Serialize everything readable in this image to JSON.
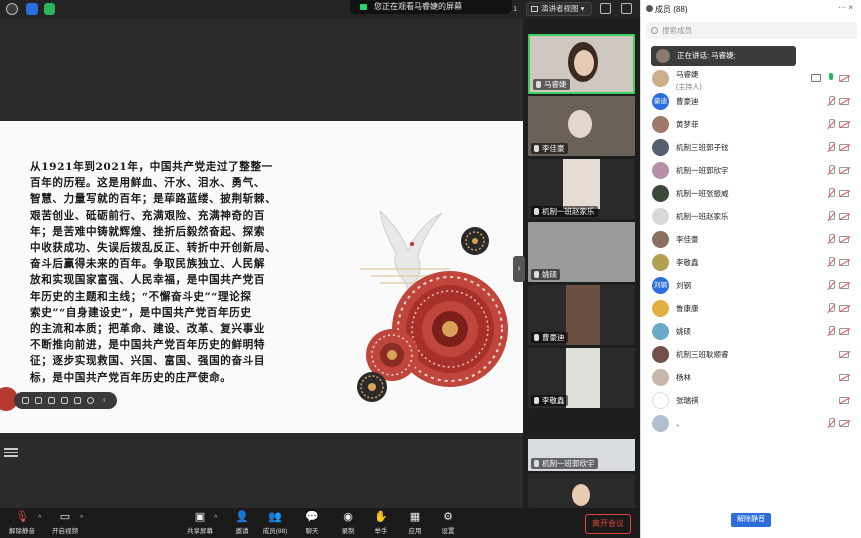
{
  "topbar": {
    "banner_text": "您正在观看马睿婕的屏幕",
    "view_button": "演讲者视图",
    "hidden_fragment": "1"
  },
  "slide": {
    "lines": [
      "从1921年到2021年，中国共产党走过了整整一",
      "百年的历程。这是用鲜血、汗水、泪水、勇气、",
      "智慧、力量写就的百年；是荜路蓝缕、披荆斩棘、",
      "艰苦创业、砥砺前行、充满艰险、充满神奇的百",
      "年；是苦难中铸就辉煌、挫折后毅然奋起、探索",
      "中收获成功、失误后拨乱反正、转折中开创新局、",
      "奋斗后赢得未来的百年。争取民族独立、人民解",
      "放和实现国家富强、人民幸福，是中国共产党百",
      "年历史的主题和主线；“不懈奋斗史”“理论探",
      "索史”“自身建设史”，是中国共产党百年历史",
      "的主流和本质；把革命、建设、改革、复兴事业",
      "不断推向前进，是中国共产党百年历史的鲜明特",
      "征；逐步实现救国、兴国、富国、强国的奋斗目",
      "标，是中国共产党百年历史的庄严使命。"
    ]
  },
  "gallery": {
    "tiles": [
      {
        "name": "马睿婕",
        "active": true
      },
      {
        "name": "李佳豪",
        "active": false
      },
      {
        "name": "机制一班赵家乐",
        "active": false
      },
      {
        "name": "姚硕",
        "active": false
      },
      {
        "name": "曹豪迪",
        "active": false
      },
      {
        "name": "李敬鑫",
        "active": false
      },
      {
        "name": "机制一班郭欣宇",
        "active": false
      }
    ]
  },
  "toolbar": {
    "mute": "解除静音",
    "video": "开启视频",
    "share": "共享屏幕",
    "invite": "邀请",
    "members": "成员(88)",
    "chat": "聊天",
    "record": "录制",
    "raise_hand": "举手",
    "apps": "应用",
    "settings": "设置",
    "leave": "离开会议"
  },
  "panel": {
    "title": "成员 (88)",
    "actions": "··· ×",
    "search_placeholder": "搜索成员",
    "speaking": "正在讲话: 马睿婕;",
    "mute_all": "解除静音",
    "participants": [
      {
        "name": "马睿婕",
        "sub": "(主持人)",
        "avatar_text": "",
        "avatar_color": "#c9b08a",
        "mic": "on",
        "cam": "off",
        "share": true
      },
      {
        "name": "曹豪迪",
        "sub": "",
        "avatar_text": "豪迪",
        "avatar_color": "#2a6fdb",
        "mic": "off",
        "cam": "off",
        "share": false
      },
      {
        "name": "黄梦菲",
        "sub": "",
        "avatar_text": "",
        "avatar_color": "#a0786a",
        "mic": "off",
        "cam": "off",
        "share": false
      },
      {
        "name": "机制三班郭子铉",
        "sub": "",
        "avatar_text": "",
        "avatar_color": "#555f6e",
        "mic": "off",
        "cam": "off",
        "share": false
      },
      {
        "name": "机制一班郭欣宇",
        "sub": "",
        "avatar_text": "",
        "avatar_color": "#b58fa8",
        "mic": "off",
        "cam": "off",
        "share": false
      },
      {
        "name": "机制一班张振威",
        "sub": "",
        "avatar_text": "",
        "avatar_color": "#3a4a3a",
        "mic": "off",
        "cam": "off",
        "share": false
      },
      {
        "name": "机制一班赵家乐",
        "sub": "",
        "avatar_text": "",
        "avatar_color": "#d8d8d8",
        "mic": "off",
        "cam": "off",
        "share": false
      },
      {
        "name": "李佳豪",
        "sub": "",
        "avatar_text": "",
        "avatar_color": "#8a7060",
        "mic": "off",
        "cam": "off",
        "share": false
      },
      {
        "name": "李敬鑫",
        "sub": "",
        "avatar_text": "",
        "avatar_color": "#b0a050",
        "mic": "off",
        "cam": "off",
        "share": false
      },
      {
        "name": "刘钢",
        "sub": "",
        "avatar_text": "刘钢",
        "avatar_color": "#2a6fdb",
        "mic": "off",
        "cam": "off",
        "share": false
      },
      {
        "name": "鲁康康",
        "sub": "",
        "avatar_text": "",
        "avatar_color": "#e0b040",
        "mic": "off",
        "cam": "off",
        "share": false
      },
      {
        "name": "姚硕",
        "sub": "",
        "avatar_text": "",
        "avatar_color": "#6aa8c8",
        "mic": "off",
        "cam": "off",
        "share": false
      },
      {
        "name": "机制三班耿顺睿",
        "sub": "",
        "avatar_text": "",
        "avatar_color": "#705048",
        "mic": "",
        "cam": "off",
        "share": false
      },
      {
        "name": "杨林",
        "sub": "",
        "avatar_text": "",
        "avatar_color": "#c8b8a8",
        "mic": "",
        "cam": "off",
        "share": false
      },
      {
        "name": "张瑞祺",
        "sub": "",
        "avatar_text": "",
        "avatar_color": "#ffffff",
        "mic": "",
        "cam": "off",
        "share": false
      },
      {
        "name": "、",
        "sub": "",
        "avatar_text": "",
        "avatar_color": "#b0c0d0",
        "mic": "off",
        "cam": "off",
        "share": false
      }
    ]
  }
}
